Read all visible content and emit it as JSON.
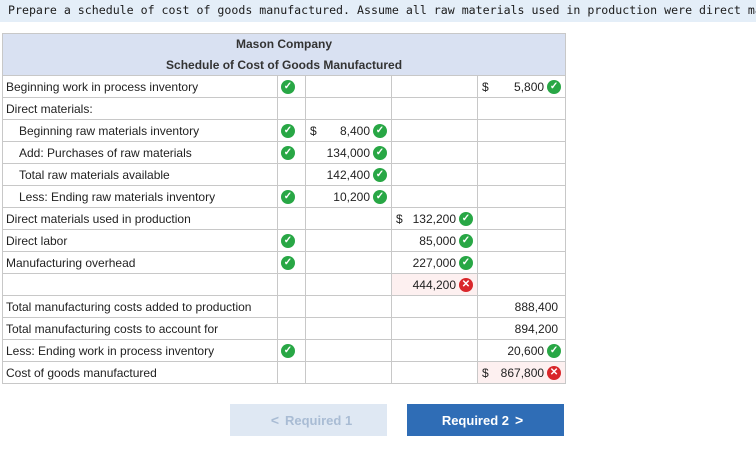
{
  "instruction": "Prepare a schedule of cost of goods manufactured. Assume all raw materials used in production were direct materials.",
  "company": "Mason Company",
  "schedule_title": "Schedule of Cost of Goods Manufactured",
  "rows": [
    {
      "label": "Beginning work in process inventory",
      "icon": "check",
      "c1": "",
      "c1_icon": "",
      "c2": "",
      "c2_icon": "",
      "c3": "5,800",
      "c3_dollar": "$",
      "c3_icon": "check"
    },
    {
      "label": "Direct materials:",
      "icon": "",
      "c1": "",
      "c2": "",
      "c3": ""
    },
    {
      "label": "Beginning raw materials inventory",
      "icon": "check",
      "c1": "8,400",
      "c1_dollar": "$",
      "c1_icon": "check",
      "c2": "",
      "c3": ""
    },
    {
      "label": "Add: Purchases of raw materials",
      "icon": "check",
      "c1": "134,000",
      "c1_icon": "check",
      "c2": "",
      "c3": ""
    },
    {
      "label": "Total raw materials available",
      "icon": "",
      "c1": "142,400",
      "c1_icon": "check",
      "c2": "",
      "c3": ""
    },
    {
      "label": "Less: Ending raw materials inventory",
      "icon": "check",
      "c1": "10,200",
      "c1_icon": "check",
      "c2": "",
      "c3": ""
    },
    {
      "label": "Direct materials used in production",
      "icon": "",
      "c1": "",
      "c2": "132,200",
      "c2_dollar": "$",
      "c2_icon": "check",
      "c3": ""
    },
    {
      "label": "Direct labor",
      "icon": "check",
      "c1": "",
      "c2": "85,000",
      "c2_icon": "check",
      "c3": ""
    },
    {
      "label": "Manufacturing overhead",
      "icon": "check",
      "c1": "",
      "c2": "227,000",
      "c2_icon": "check",
      "c3": ""
    },
    {
      "label": "",
      "icon": "",
      "c1": "",
      "c2": "444,200",
      "c2_icon": "x",
      "c3": ""
    },
    {
      "label": "Total manufacturing costs added to production",
      "icon": "",
      "c1": "",
      "c2": "",
      "c3": "888,400"
    },
    {
      "label": "Total manufacturing costs to account for",
      "icon": "",
      "c1": "",
      "c2": "",
      "c3": "894,200"
    },
    {
      "label": "Less: Ending work in process inventory",
      "icon": "check",
      "c1": "",
      "c2": "",
      "c3": "20,600",
      "c3_icon": "check"
    },
    {
      "label": "Cost of goods manufactured",
      "icon": "",
      "c1": "",
      "c2": "",
      "c3": "867,800",
      "c3_dollar": "$",
      "c3_icon": "x"
    }
  ],
  "nav": {
    "prev_label": "Required 1",
    "prev_arrow": "<",
    "next_label": "Required 2",
    "next_arrow": ">"
  },
  "colors": {
    "header_bg": "#d9e1f2",
    "check": "#28a745",
    "error": "#d9262a",
    "next_button": "#2f6db6",
    "prev_button": "#dfe8f3"
  }
}
